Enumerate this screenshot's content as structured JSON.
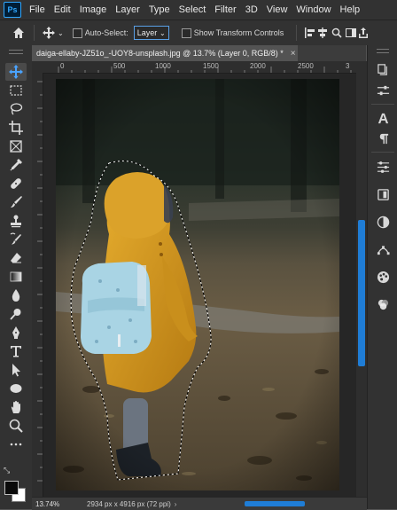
{
  "menu": {
    "logo": "Ps",
    "items": [
      "File",
      "Edit",
      "Image",
      "Layer",
      "Type",
      "Select",
      "Filter",
      "3D",
      "View",
      "Window",
      "Help"
    ]
  },
  "options": {
    "auto_select_label": "Auto-Select:",
    "layer_select_value": "Layer",
    "show_transform_label": "Show Transform Controls"
  },
  "document": {
    "tab_title": "daiga-ellaby-JZ51o_-UOY8-unsplash.jpg @ 13.7% (Layer 0, RGB/8) *",
    "close_glyph": "×"
  },
  "ruler": {
    "top_labels": [
      "0",
      "500",
      "1000",
      "1500",
      "2000",
      "2500",
      "3"
    ]
  },
  "status": {
    "zoom": "13.74%",
    "dimensions": "2934 px x 4916 px (72 ppi)"
  },
  "colors": {
    "accent": "#1f7dd6",
    "panel": "#323232",
    "workspace": "#262626",
    "coat": "#d69a1e",
    "backpack": "#9fcfe0"
  },
  "tools": [
    "move-icon",
    "marquee-icon",
    "lasso-icon",
    "crop-icon",
    "frame-icon",
    "eyedropper-icon",
    "healing-icon",
    "brush-icon",
    "stamp-icon",
    "history-brush-icon",
    "eraser-icon",
    "gradient-icon",
    "blur-icon",
    "dodge-icon",
    "pen-icon",
    "type-icon",
    "path-select-icon",
    "ellipse-icon",
    "hand-icon",
    "zoom-icon",
    "edit-toolbar-icon"
  ],
  "panels": [
    "history-icon",
    "properties-icon",
    "character-icon",
    "paragraph-icon",
    "adjustments-icon",
    "libraries-icon",
    "color-icon",
    "paths-icon",
    "swatches-icon",
    "styles-icon"
  ]
}
